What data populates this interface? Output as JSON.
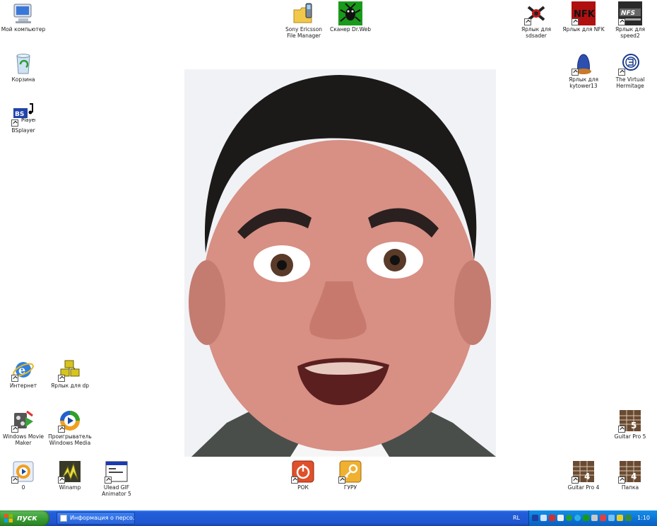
{
  "desktop": {
    "icons": [
      {
        "label": "Мой компьютер",
        "icon": "my-computer-icon",
        "shortcut": false
      },
      {
        "label": "Корзина",
        "icon": "recycle-bin-icon",
        "shortcut": false
      },
      {
        "label": "BSplayer",
        "icon": "bsplayer-icon",
        "shortcut": true
      },
      {
        "label": "Sony Ericsson File Manager",
        "icon": "file-manager-icon",
        "shortcut": false
      },
      {
        "label": "Сканер Dr.Web",
        "icon": "drweb-scanner-icon",
        "shortcut": false
      },
      {
        "label": "Ярлык для sdsader",
        "icon": "sdsader-icon",
        "shortcut": true
      },
      {
        "label": "Ярлык для NFK",
        "icon": "nfk-icon",
        "shortcut": true
      },
      {
        "label": "Ярлык для speed2",
        "icon": "nfs-speed2-icon",
        "shortcut": true
      },
      {
        "label": "Ярлык для kytower13",
        "icon": "kytower-icon",
        "shortcut": true
      },
      {
        "label": "The Virtual Hermitage",
        "icon": "virtual-hermitage-icon",
        "shortcut": true
      },
      {
        "label": "Интернет",
        "icon": "internet-explorer-icon",
        "shortcut": true
      },
      {
        "label": "Ярлык для dp",
        "icon": "dp-icon",
        "shortcut": true
      },
      {
        "label": "Windows Movie Maker",
        "icon": "movie-maker-icon",
        "shortcut": true
      },
      {
        "label": "Проигрыватель Windows Media",
        "icon": "windows-media-player-icon",
        "shortcut": true
      },
      {
        "label": "0",
        "icon": "media-player-icon",
        "shortcut": true
      },
      {
        "label": "Winamp",
        "icon": "winamp-icon",
        "shortcut": true
      },
      {
        "label": "Ulead GIF Animator 5",
        "icon": "gif-animator-icon",
        "shortcut": true
      },
      {
        "label": "РОК",
        "icon": "power-icon",
        "shortcut": true
      },
      {
        "label": "ГУРУ",
        "icon": "key-icon",
        "shortcut": true
      },
      {
        "label": "Guitar Pro 5",
        "icon": "guitar-pro-5-icon",
        "shortcut": true
      },
      {
        "label": "Guitar Pro 4",
        "icon": "guitar-pro-4-icon",
        "shortcut": true
      },
      {
        "label": "Папка",
        "icon": "guitar-pro-folder-icon",
        "shortcut": true
      }
    ]
  },
  "taskbar": {
    "start_label": "пуск",
    "tasks": [
      {
        "label": "Информация о персо...",
        "icon": "window-icon"
      }
    ],
    "language": "RL",
    "tray_icons": [
      "network-icon",
      "network-icon",
      "antivirus-icon",
      "display-icon",
      "messenger-icon",
      "update-icon",
      "drweb-icon",
      "volume-icon",
      "volume-icon",
      "safe-remove-icon",
      "shield-icon",
      "security-icon"
    ],
    "clock": "1:10"
  },
  "colors": {
    "taskbar": "#245edb",
    "start_button": "#36982f",
    "tray": "#0c70d3"
  }
}
